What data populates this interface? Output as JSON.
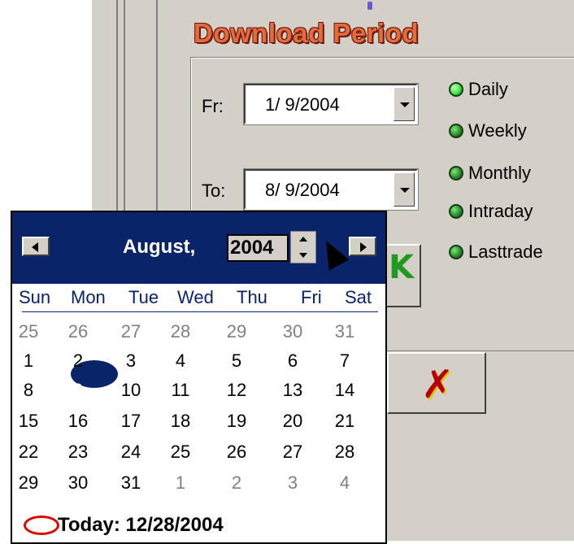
{
  "panel": {
    "title": "Download Period",
    "from_label": "Fr:",
    "from_value": "1/ 9/2004",
    "to_label": "To:",
    "to_value": "8/ 9/2004",
    "options": [
      {
        "label": "Daily",
        "selected": true
      },
      {
        "label": "Weekly",
        "selected": false
      },
      {
        "label": "Monthly",
        "selected": false
      },
      {
        "label": "Intraday",
        "selected": false
      },
      {
        "label": "Lasttrade",
        "selected": false
      }
    ]
  },
  "calendar": {
    "month_label": "August,",
    "year": "2004",
    "days_of_week": [
      "Sun",
      "Mon",
      "Tue",
      "Wed",
      "Thu",
      "Fri",
      "Sat"
    ],
    "weeks": [
      [
        "25",
        "26",
        "27",
        "28",
        "29",
        "30",
        "31"
      ],
      [
        "1",
        "2",
        "3",
        "4",
        "5",
        "6",
        "7"
      ],
      [
        "8",
        "9",
        "10",
        "11",
        "12",
        "13",
        "14"
      ],
      [
        "15",
        "16",
        "17",
        "18",
        "19",
        "20",
        "21"
      ],
      [
        "22",
        "23",
        "24",
        "25",
        "26",
        "27",
        "28"
      ],
      [
        "29",
        "30",
        "31",
        "1",
        "2",
        "3",
        "4"
      ]
    ],
    "selected_day": "9",
    "today_label": "Today: 12/28/2004"
  },
  "colors": {
    "header": "#0a246a",
    "title": "#e56b3b",
    "led_on": "#3ee83e"
  }
}
